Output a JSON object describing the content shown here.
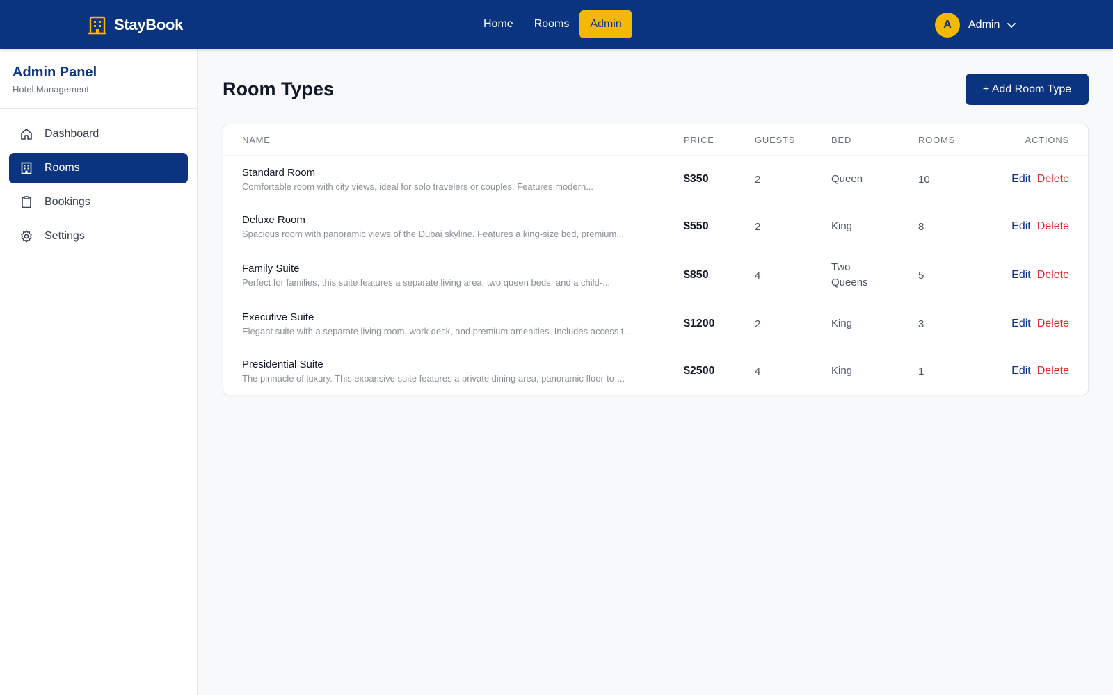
{
  "brand": {
    "name": "StayBook",
    "icon": "building-icon"
  },
  "nav": {
    "links": [
      {
        "label": "Home",
        "active": false
      },
      {
        "label": "Rooms",
        "active": false
      },
      {
        "label": "Admin",
        "active": true
      }
    ]
  },
  "user": {
    "initial": "A",
    "name": "Admin",
    "icon": "chevron-down-icon"
  },
  "sidebar": {
    "title": "Admin Panel",
    "subtitle": "Hotel Management",
    "items": [
      {
        "label": "Dashboard",
        "icon": "home-icon",
        "active": false
      },
      {
        "label": "Rooms",
        "icon": "building-icon",
        "active": true
      },
      {
        "label": "Bookings",
        "icon": "clipboard-icon",
        "active": false
      },
      {
        "label": "Settings",
        "icon": "gear-icon",
        "active": false
      }
    ]
  },
  "page": {
    "title": "Room Types",
    "add_label": "+ Add Room Type"
  },
  "table": {
    "headers": {
      "name": "Name",
      "price": "Price",
      "guests": "Guests",
      "bed": "Bed",
      "rooms": "Rooms",
      "actions": "Actions"
    },
    "rows": [
      {
        "name": "Standard Room",
        "desc": "Comfortable room with city views, ideal for solo travelers or couples. Features modern...",
        "price": "$350",
        "guests": "2",
        "bed": "Queen",
        "rooms": "10",
        "edit": "Edit",
        "delete": "Delete"
      },
      {
        "name": "Deluxe Room",
        "desc": "Spacious room with panoramic views of the Dubai skyline. Features a king-size bed, premium...",
        "price": "$550",
        "guests": "2",
        "bed": "King",
        "rooms": "8",
        "edit": "Edit",
        "delete": "Delete"
      },
      {
        "name": "Family Suite",
        "desc": "Perfect for families, this suite features a separate living area, two queen beds, and a child-...",
        "price": "$850",
        "guests": "4",
        "bed": "Two Queens",
        "rooms": "5",
        "edit": "Edit",
        "delete": "Delete"
      },
      {
        "name": "Executive Suite",
        "desc": "Elegant suite with a separate living room, work desk, and premium amenities. Includes access t...",
        "price": "$1200",
        "guests": "2",
        "bed": "King",
        "rooms": "3",
        "edit": "Edit",
        "delete": "Delete"
      },
      {
        "name": "Presidential Suite",
        "desc": "The pinnacle of luxury. This expansive suite features a private dining area, panoramic floor-to-...",
        "price": "$2500",
        "guests": "4",
        "bed": "King",
        "rooms": "1",
        "edit": "Edit",
        "delete": "Delete"
      }
    ]
  },
  "colors": {
    "primary": "#0a3380",
    "accent": "#f5b800",
    "danger": "#dc2626"
  }
}
